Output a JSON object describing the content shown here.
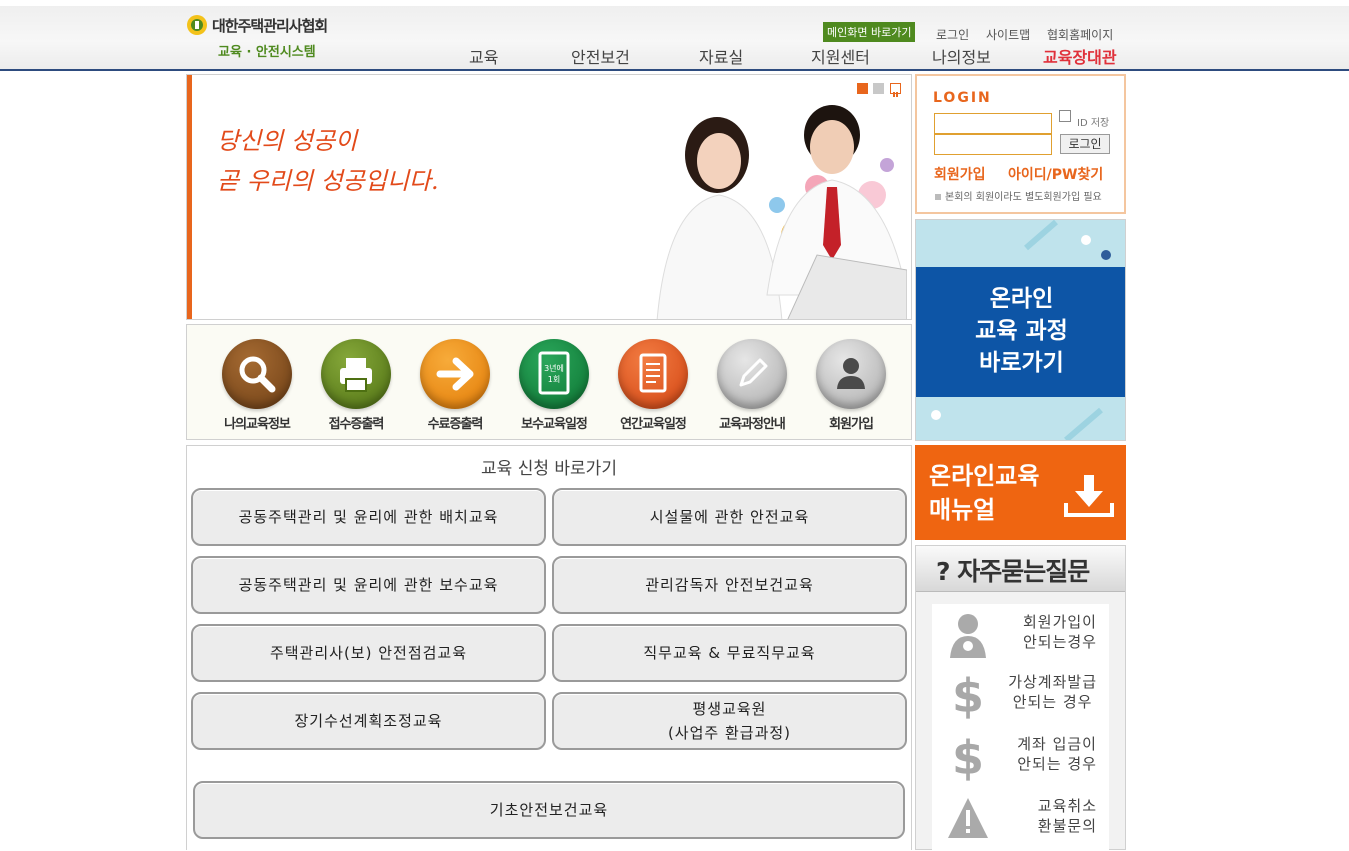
{
  "header": {
    "org_name": "대한주택관리사협회",
    "system_name": "교육 · 안전시스템",
    "util_links": [
      "메인화면 바로가기",
      "로그인",
      "사이트맵",
      "협회홈페이지"
    ],
    "nav": [
      "교육",
      "안전보건",
      "자료실",
      "지원센터",
      "나의정보",
      "교육장대관"
    ]
  },
  "banner": {
    "line1": "당신의 성공이",
    "line2": "곧 우리의 성공입니다."
  },
  "quick_menu": [
    {
      "label": "나의교육정보",
      "icon": "search-icon",
      "color": "#7a4a1f"
    },
    {
      "label": "접수증출력",
      "icon": "printer-icon",
      "color": "#5c7f1c"
    },
    {
      "label": "수료증출력",
      "icon": "arrow-right-icon",
      "color": "#ee8a12"
    },
    {
      "label": "보수교육일정",
      "icon": "calendar-icon",
      "color": "#138a3d",
      "icon_text": "3년에\n1회"
    },
    {
      "label": "연간교육일정",
      "icon": "document-icon",
      "color": "#e2511c"
    },
    {
      "label": "교육과정안내",
      "icon": "pencil-icon",
      "color": "#b9b9b9"
    },
    {
      "label": "회원가입",
      "icon": "person-icon",
      "color": "#b9b9b9"
    }
  ],
  "edu_apply": {
    "title": "교육 신청 바로가기",
    "buttons": [
      "공동주택관리 및 윤리에 관한 배치교육",
      "시설물에 관한 안전교육",
      "공동주택관리 및 윤리에 관한 보수교육",
      "관리감독자 안전보건교육",
      "주택관리사(보) 안전점검교육",
      "직무교육 & 무료직무교육",
      "장기수선계획조정교육",
      "평생교육원",
      "(사업주 환급과정)",
      "기초안전보건교육"
    ]
  },
  "login": {
    "title": "LOGIN",
    "id_save": "ID 저장",
    "button": "로그인",
    "join": "회원가입",
    "find": "아이디/PW찾기",
    "note": "본회의 회원이라도 별도회원가입 필요"
  },
  "online": {
    "line1": "온라인",
    "line2": "교육 과정",
    "line3": "바로가기"
  },
  "manual": {
    "line1": "온라인교육",
    "line2": "매뉴얼"
  },
  "faq": {
    "title": "? 자주묻는질문",
    "items": [
      {
        "line1": "회원가입이",
        "line2": "안되는경우",
        "icon": "person-info-icon"
      },
      {
        "line1": "가상계좌발급",
        "line2": "안되는 경우",
        "icon": "dollar-icon"
      },
      {
        "line1": "계좌 입금이",
        "line2": "안되는 경우",
        "icon": "dollar-icon"
      },
      {
        "line1": "교육취소",
        "line2": "환불문의",
        "icon": "warning-icon"
      }
    ]
  }
}
